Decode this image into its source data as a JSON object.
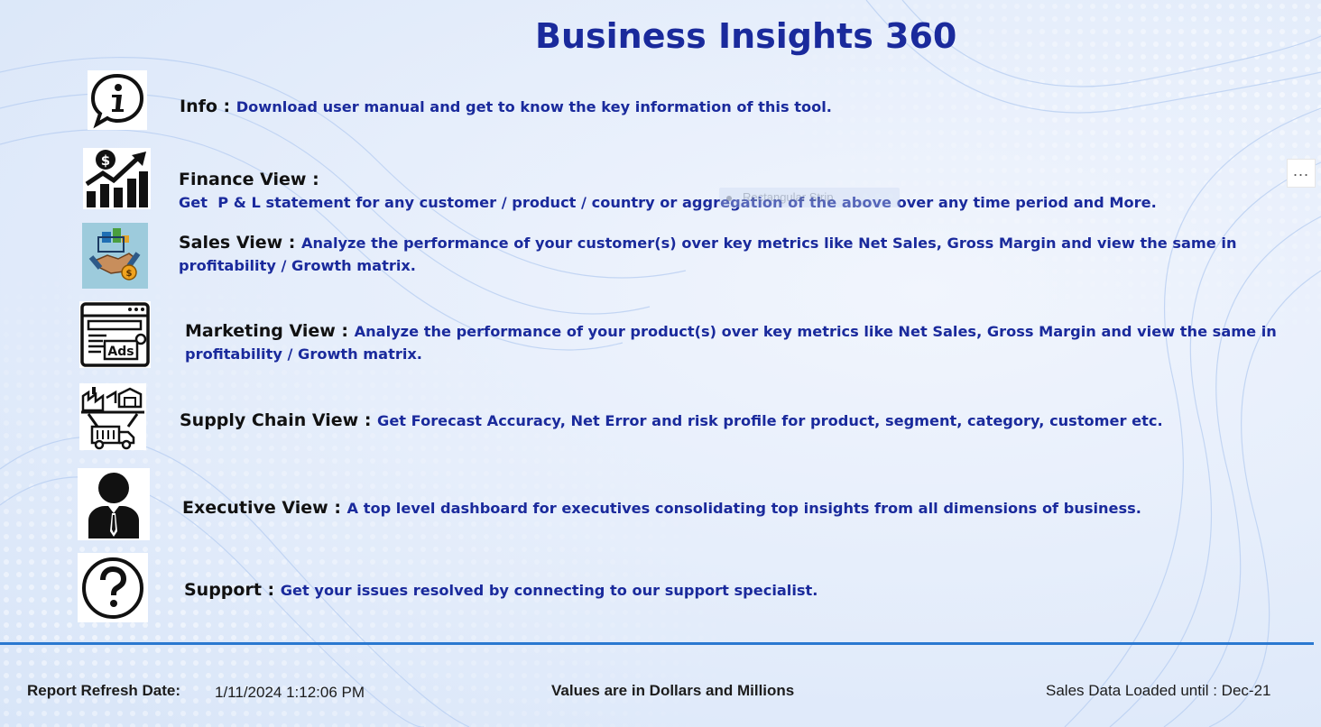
{
  "title": "Business Insights 360",
  "items": [
    {
      "label": "Info",
      "sep": " : ",
      "desc": "Download user manual and get to know the key information of this tool.",
      "icon": "info-icon"
    },
    {
      "label": "Finance View",
      "sep": " : ",
      "desc": "Get  P & L statement for any customer / product / country or aggregation of the above over any time period and More.",
      "icon": "finance-chart-icon"
    },
    {
      "label": "Sales View",
      "sep": " : ",
      "desc": "Analyze the performance of your customer(s) over key metrics like Net Sales, Gross Margin and view the same in profitability / Growth matrix.",
      "icon": "handshake-icon"
    },
    {
      "label": "Marketing View",
      "sep": " : ",
      "desc": "Analyze the performance of your product(s) over key metrics like Net Sales, Gross Margin and view the same in profitability / Growth matrix.",
      "icon": "ads-browser-icon"
    },
    {
      "label": "Supply Chain View",
      "sep": " : ",
      "desc": "Get Forecast Accuracy, Net Error and risk profile for product, segment, category, customer etc.",
      "icon": "supply-chain-icon"
    },
    {
      "label": "Executive View",
      "sep": " : ",
      "desc": "A top level dashboard for executives consolidating top insights from all dimensions of business.",
      "icon": "executive-person-icon"
    },
    {
      "label": "Support",
      "sep": " : ",
      "desc": "Get your issues resolved by connecting to our support specialist.",
      "icon": "question-mark-icon"
    }
  ],
  "more_options": "...",
  "ghost_strip": "Rectangular Strip",
  "footer": {
    "refresh_label": "Report Refresh Date:",
    "refresh_value": "1/11/2024 1:12:06 PM",
    "units_note": "Values are in Dollars and Millions",
    "sales_loaded": "Sales Data Loaded until : Dec-21"
  },
  "colors": {
    "title": "#1a2a9c",
    "desc": "#1a2a9c",
    "divider": "#2a78d0"
  }
}
